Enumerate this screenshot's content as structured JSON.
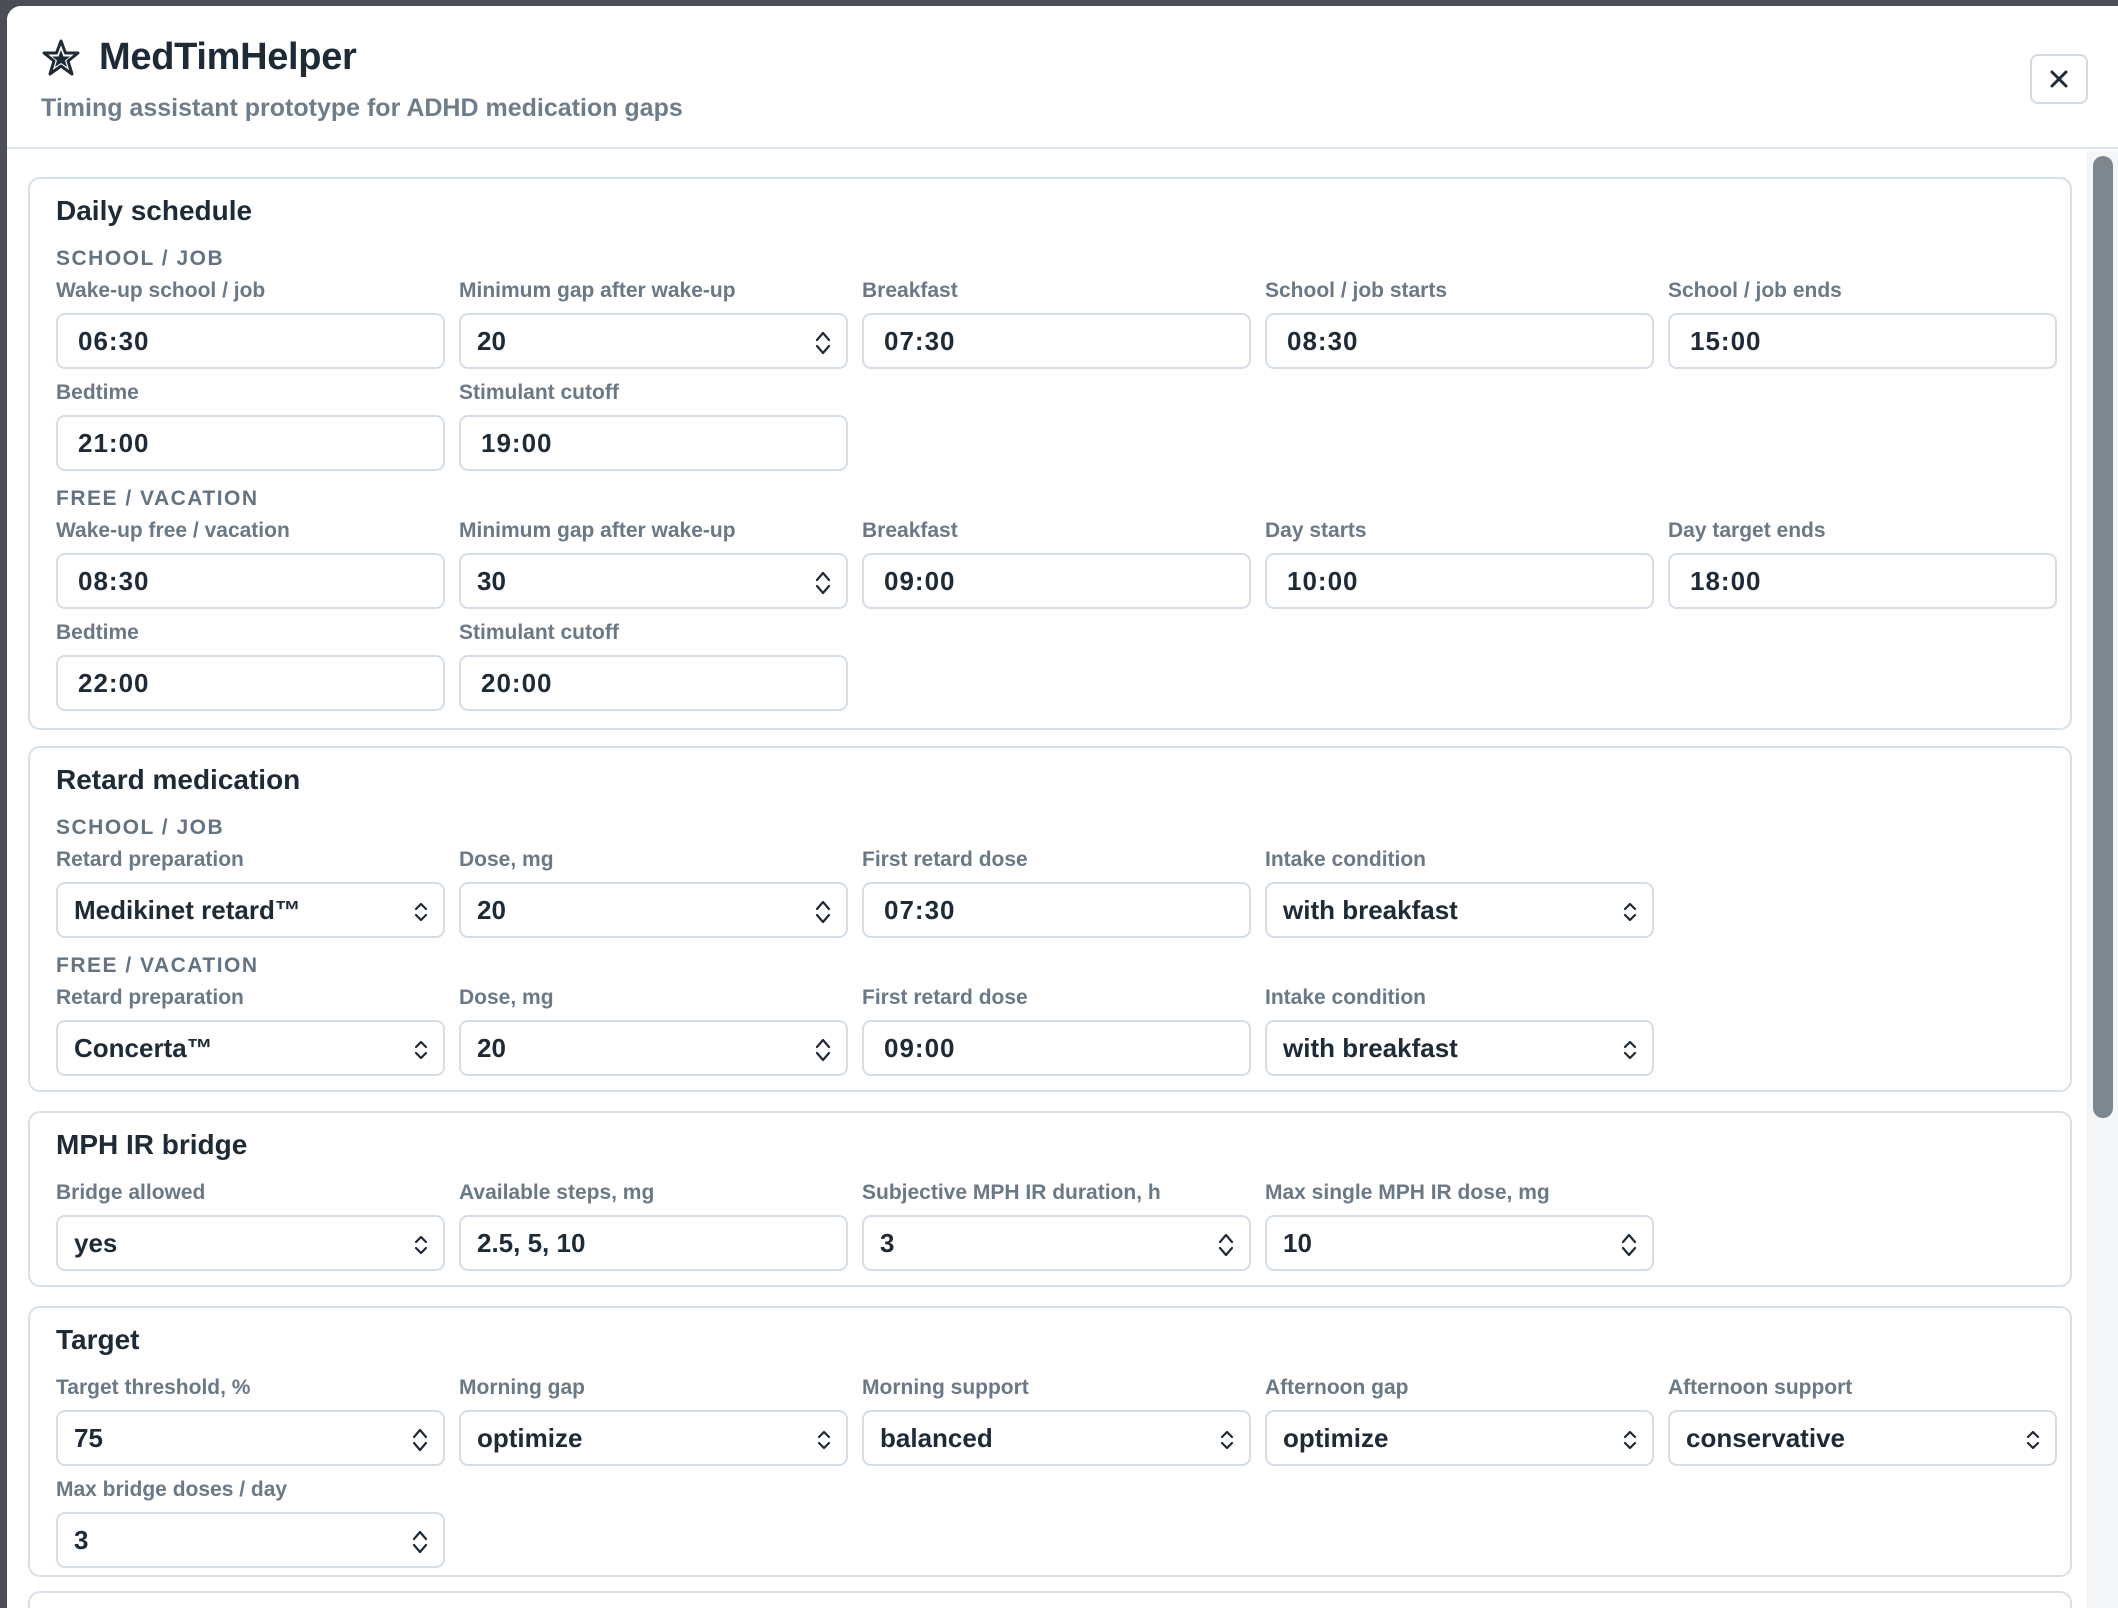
{
  "app": {
    "title": "MedTimHelper",
    "subtitle": "Timing assistant prototype for ADHD medication gaps",
    "close_label": "×"
  },
  "daily": {
    "title": "Daily schedule",
    "school_group": "SCHOOL / JOB",
    "school": {
      "wake_label": "Wake-up school / job",
      "wake_value": "06:30",
      "gap_label": "Minimum gap after wake-up",
      "gap_value": "20",
      "breakfast_label": "Breakfast",
      "breakfast_value": "07:30",
      "start_label": "School / job starts",
      "start_value": "08:30",
      "end_label": "School / job ends",
      "end_value": "15:00",
      "bed_label": "Bedtime",
      "bed_value": "21:00",
      "cutoff_label": "Stimulant cutoff",
      "cutoff_value": "19:00"
    },
    "free_group": "FREE / VACATION",
    "free": {
      "wake_label": "Wake-up free / vacation",
      "wake_value": "08:30",
      "gap_label": "Minimum gap after wake-up",
      "gap_value": "30",
      "breakfast_label": "Breakfast",
      "breakfast_value": "09:00",
      "start_label": "Day starts",
      "start_value": "10:00",
      "end_label": "Day target ends",
      "end_value": "18:00",
      "bed_label": "Bedtime",
      "bed_value": "22:00",
      "cutoff_label": "Stimulant cutoff",
      "cutoff_value": "20:00"
    }
  },
  "retard": {
    "title": "Retard medication",
    "school_group": "SCHOOL / JOB",
    "school": {
      "prep_label": "Retard preparation",
      "prep_value": "Medikinet retard™",
      "dose_label": "Dose, mg",
      "dose_value": "20",
      "first_label": "First retard dose",
      "first_value": "07:30",
      "cond_label": "Intake condition",
      "cond_value": "with breakfast"
    },
    "free_group": "FREE / VACATION",
    "free": {
      "prep_label": "Retard preparation",
      "prep_value": "Concerta™",
      "dose_label": "Dose, mg",
      "dose_value": "20",
      "first_label": "First retard dose",
      "first_value": "09:00",
      "cond_label": "Intake condition",
      "cond_value": "with breakfast"
    }
  },
  "bridge": {
    "title": "MPH IR bridge",
    "allowed_label": "Bridge allowed",
    "allowed_value": "yes",
    "steps_label": "Available steps, mg",
    "steps_value": "2.5, 5, 10",
    "duration_label": "Subjective MPH IR duration, h",
    "duration_value": "3",
    "max_label": "Max single MPH IR dose, mg",
    "max_value": "10"
  },
  "target": {
    "title": "Target",
    "threshold_label": "Target threshold, %",
    "threshold_value": "75",
    "morning_gap_label": "Morning gap",
    "morning_gap_value": "optimize",
    "morning_support_label": "Morning support",
    "morning_support_value": "balanced",
    "afternoon_gap_label": "Afternoon gap",
    "afternoon_gap_value": "optimize",
    "afternoon_support_label": "Afternoon support",
    "afternoon_support_value": "conservative",
    "max_bridge_label": "Max bridge doses / day",
    "max_bridge_value": "3"
  },
  "icons": {
    "logo": "star-icon",
    "close": "close-icon",
    "number": "spinner-icon",
    "select": "chevron-updown-icon"
  }
}
